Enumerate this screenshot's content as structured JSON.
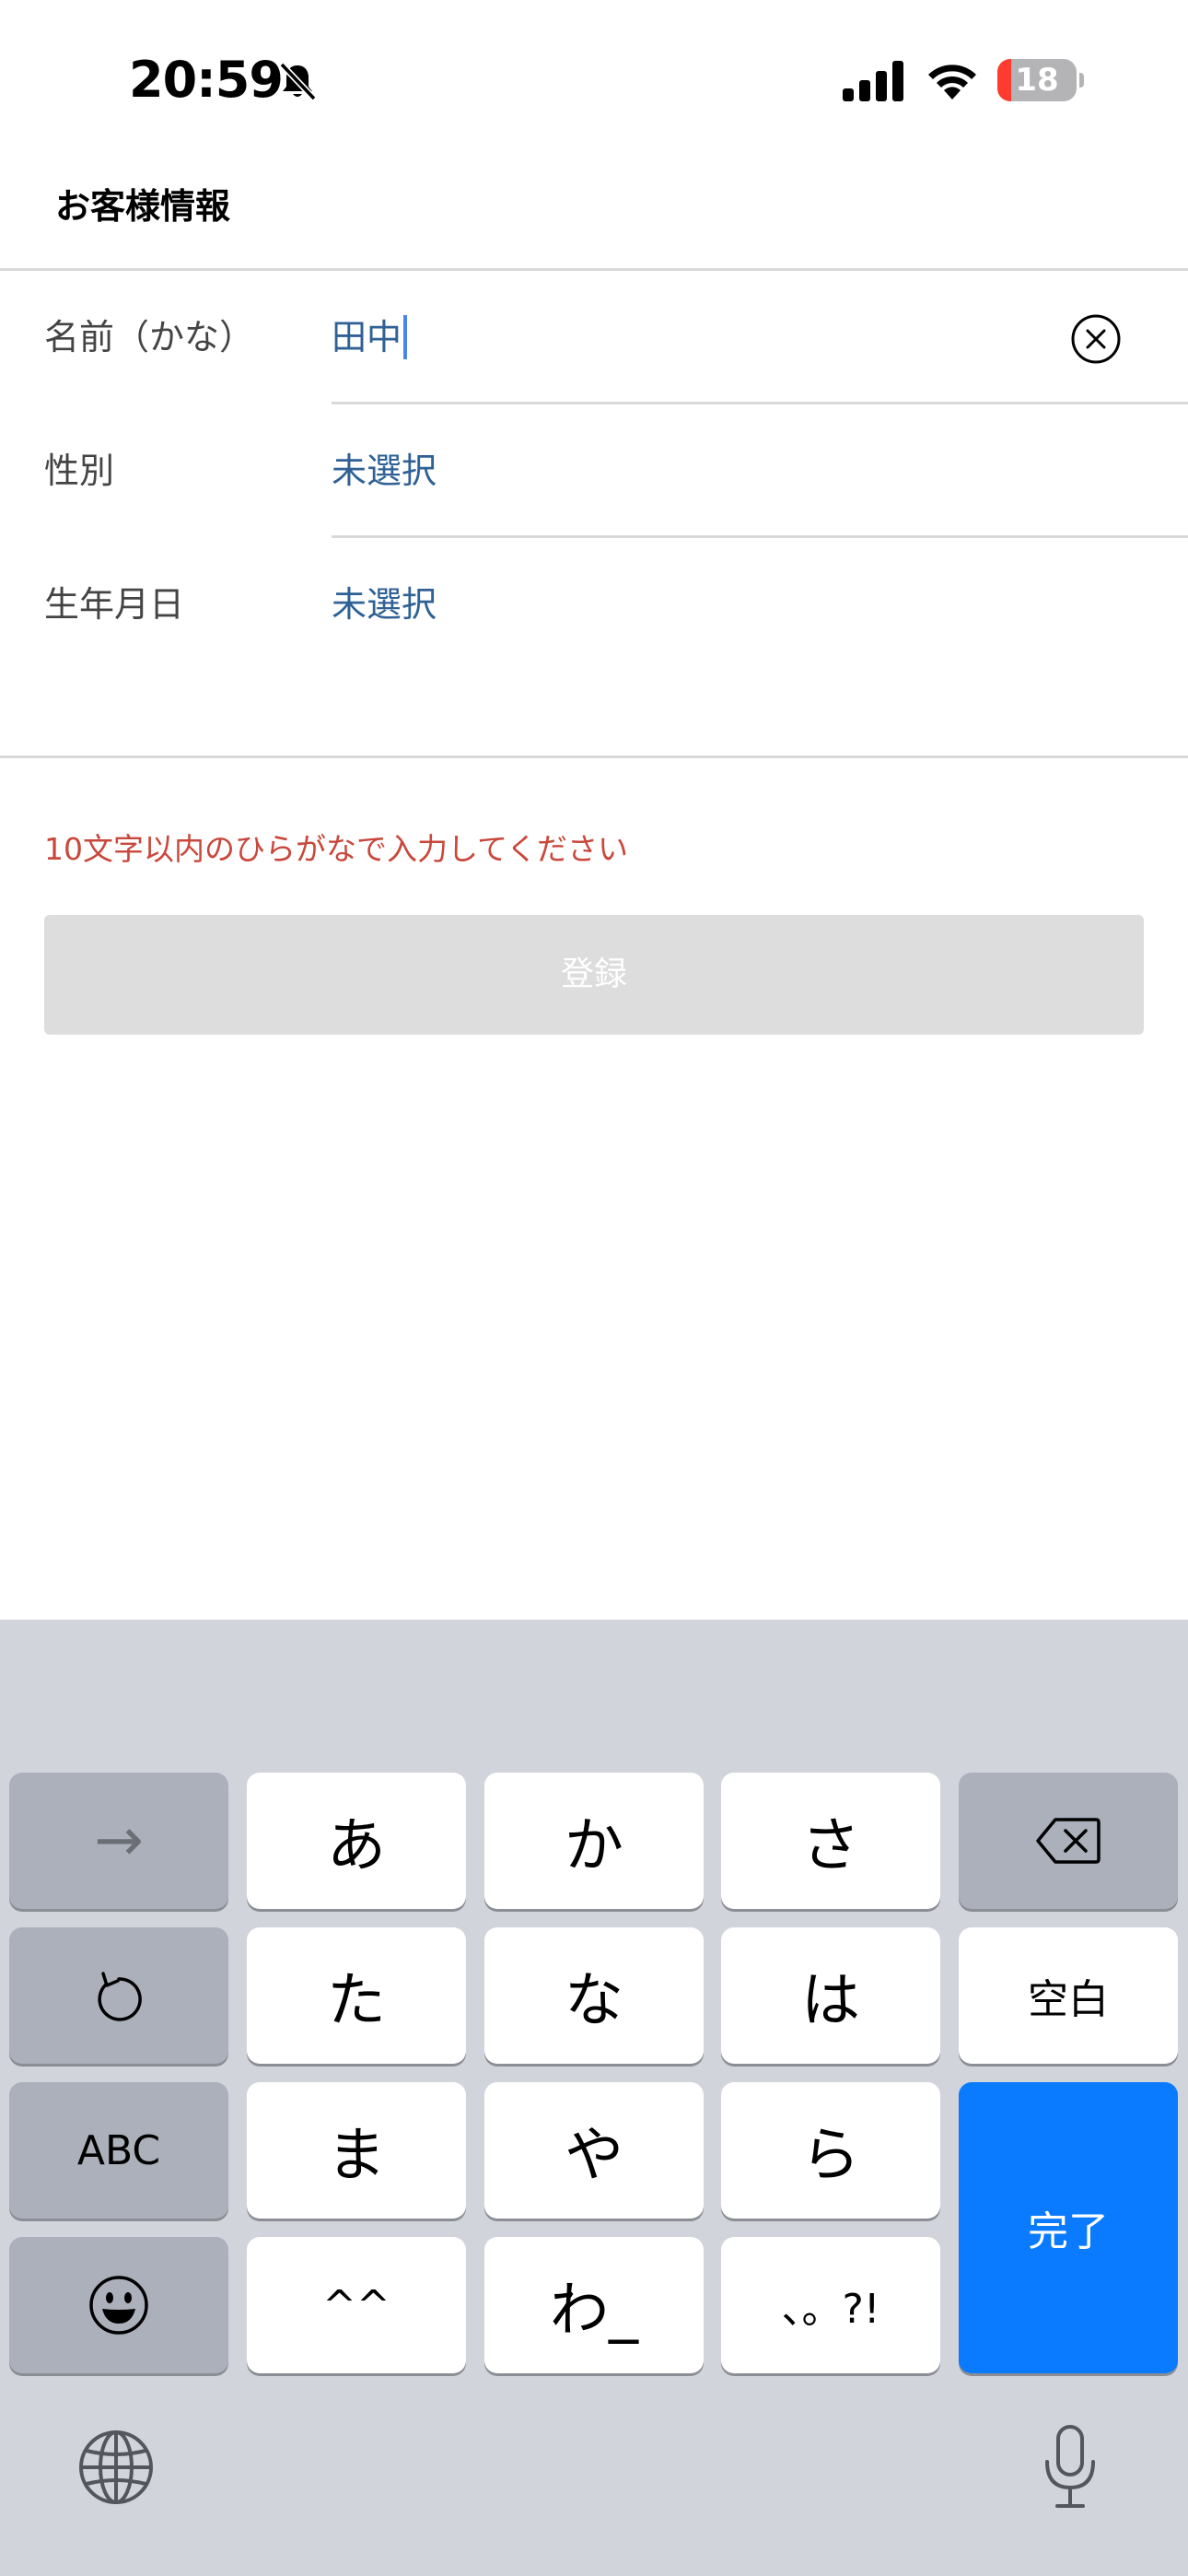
{
  "status_bar": {
    "time": "20:59",
    "battery_level": "18",
    "battery_fraction": 0.18,
    "icons": [
      "bell-slash-icon",
      "cellular-signal-icon",
      "wifi-icon",
      "battery-icon"
    ]
  },
  "header": {
    "title": "お客様情報"
  },
  "form": {
    "rows": [
      {
        "label": "名前（かな）",
        "value": "田中"
      },
      {
        "label": "性別",
        "value": "未選択"
      },
      {
        "label": "生年月日",
        "value": "未選択"
      }
    ],
    "error_message": "10文字以内のひらがなで入力してください",
    "register_label": "登録"
  },
  "keyboard": {
    "rows": [
      [
        "→",
        "あ",
        "か",
        "さ",
        "delete"
      ],
      [
        "undo",
        "た",
        "な",
        "は",
        "空白"
      ],
      [
        "ABC",
        "ま",
        "や",
        "ら",
        "完了"
      ],
      [
        "emoji",
        "^^",
        "わ_",
        "、。?!"
      ]
    ],
    "keys": {
      "arrow": "→",
      "a": "あ",
      "ka": "か",
      "sa": "さ",
      "ta": "た",
      "na": "な",
      "ha": "は",
      "space": "空白",
      "abc": "ABC",
      "ma": "ま",
      "ya": "や",
      "ra": "ら",
      "done": "完了",
      "kaomoji": "^^",
      "wa": "わ_",
      "punct": "、。?!"
    },
    "colors": {
      "done": "#0a7afe",
      "function_key": "#abb0ba",
      "background": "#d1d4db"
    },
    "bottom_icons": [
      "globe-icon",
      "microphone-icon"
    ]
  },
  "colors": {
    "value_text": "#2f6195",
    "error_text": "#c9473b",
    "disabled_button": "#dddddd"
  }
}
